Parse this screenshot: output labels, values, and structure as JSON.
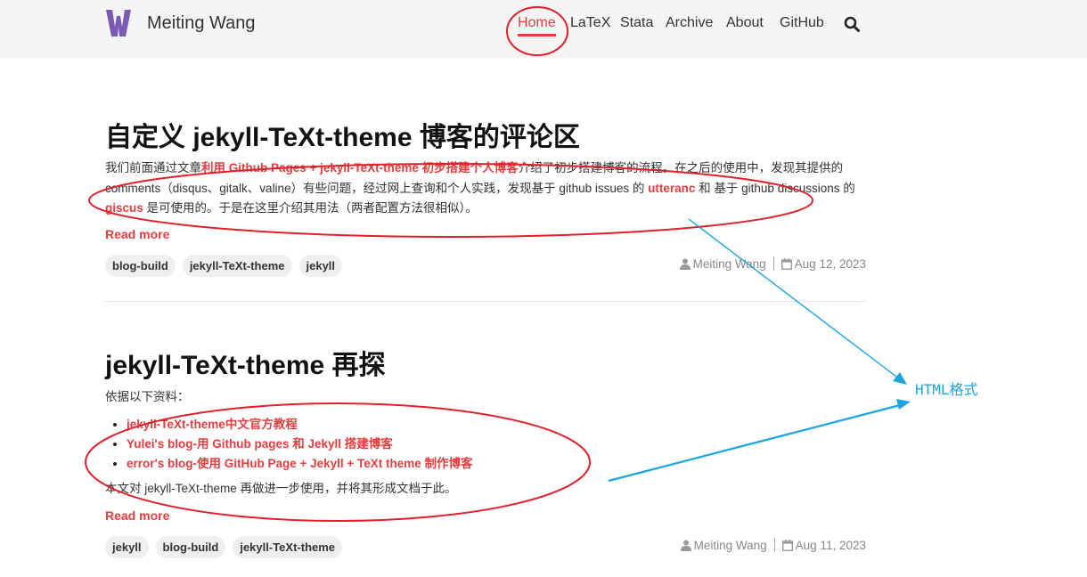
{
  "site": {
    "brand_name": "Meiting Wang",
    "logo_letter": "W",
    "logo_color": "#7b5ab6",
    "accent_color": "#e53d3d"
  },
  "nav": {
    "items": [
      "Home",
      "LaTeX",
      "Stata",
      "Archive",
      "About",
      "GitHub"
    ],
    "active": "Home",
    "search_icon": "search-icon"
  },
  "posts": [
    {
      "title": "自定义 jekyll-TeXt-theme 博客的评论区",
      "excerpt": {
        "text1": "我们前面通过文章",
        "link1": "利用 Github Pages + jekyll-TeXt-theme 初步搭建个人博客",
        "text2": "介绍了初步搭建博客的流程。在之后的使用中，发现其提供的 comments（disqus、gitalk、valine）有些问题，经过网上查询和个人实践，发现基于 github issues 的 ",
        "link2": "utteranc",
        "text3": " 和 基于 github discussions 的 ",
        "link3": "giscus",
        "text4": " 是可使用的。于是在这里介绍其用法（两者配置方法很相似）。"
      },
      "read_more": "Read more",
      "tags": [
        "blog-build",
        "jekyll-TeXt-theme",
        "jekyll"
      ],
      "author": "Meiting Wang",
      "date": "Aug 12, 2023"
    },
    {
      "title": "jekyll-TeXt-theme 再探",
      "intro": "依据以下资料：",
      "refs": [
        "jekyll-TeXt-theme中文官方教程",
        "Yulei's blog-用 Github pages 和 Jekyll 搭建博客",
        "error's blog-使用 GitHub Page + Jekyll + TeXt theme 制作博客"
      ],
      "outro": "本文对 jekyll-TeXt-theme 再做进一步使用，并将其形成文档于此。",
      "read_more": "Read more",
      "tags": [
        "jekyll",
        "blog-build",
        "jekyll-TeXt-theme"
      ],
      "author": "Meiting Wang",
      "date": "Aug 11, 2023"
    }
  ],
  "annotation": {
    "note": "HTML格式",
    "ellipse_color": "#e0202a",
    "arrow_color": "#1aa4e0"
  }
}
